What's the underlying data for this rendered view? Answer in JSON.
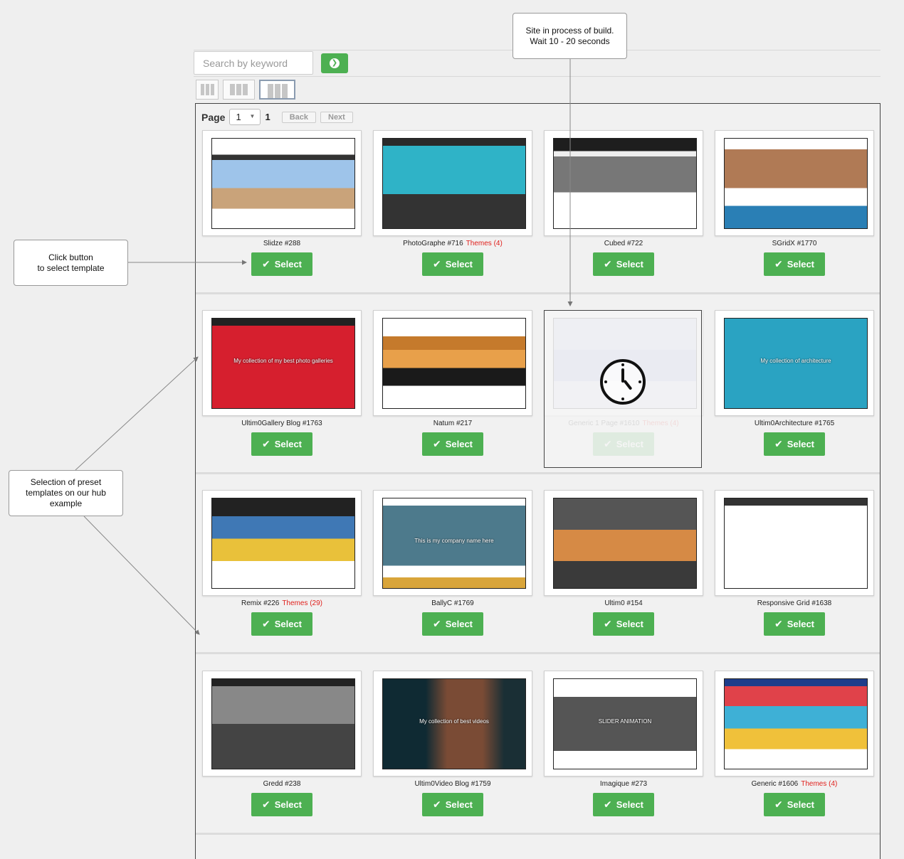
{
  "search": {
    "placeholder": "Search by keyword",
    "go_icon": "arrow-right-circle-icon"
  },
  "view_modes": [
    "grid-small",
    "grid-medium",
    "grid-large"
  ],
  "pager": {
    "label": "Page",
    "current": "1",
    "total": "1",
    "back": "Back",
    "next": "Next"
  },
  "select_label": "Select",
  "cards": [
    {
      "name": "Slidze #288",
      "themes": ""
    },
    {
      "name": "PhotoGraphe #716",
      "themes": "Themes (4)"
    },
    {
      "name": "Cubed #722",
      "themes": ""
    },
    {
      "name": "SGridX #1770",
      "themes": ""
    },
    {
      "name": "Ultim0Gallery Blog #1763",
      "themes": "",
      "overlay_text": "My collection of my best photo galleries"
    },
    {
      "name": "Natum #217",
      "themes": ""
    },
    {
      "name": "Generic 1 Page #1610",
      "themes": "Themes (4)",
      "building": true
    },
    {
      "name": "Ultim0Architecture #1765",
      "themes": "",
      "overlay_text": "My collection of architecture"
    },
    {
      "name": "Remix #226",
      "themes": "Themes (29)"
    },
    {
      "name": "BallyC #1769",
      "themes": "",
      "overlay_text": "This is my company name here"
    },
    {
      "name": "Ultim0 #154",
      "themes": ""
    },
    {
      "name": "Responsive Grid #1638",
      "themes": ""
    },
    {
      "name": "Gredd #238",
      "themes": ""
    },
    {
      "name": "Ultim0Video Blog #1759",
      "themes": "",
      "overlay_text": "My collection of best videos"
    },
    {
      "name": "Imagique #273",
      "themes": "",
      "overlay_text": "SLIDER ANIMATION"
    },
    {
      "name": "Generic #1606",
      "themes": "Themes (4)"
    }
  ],
  "callouts": {
    "build": [
      "Site in process of build.",
      "Wait 10 - 20 seconds"
    ],
    "select": [
      "Click button",
      "to select template"
    ],
    "preset": [
      "Selection of preset",
      "templates on our hub",
      "example"
    ]
  },
  "colors": {
    "accent_green": "#4db052",
    "themes_red": "#e0201c"
  }
}
